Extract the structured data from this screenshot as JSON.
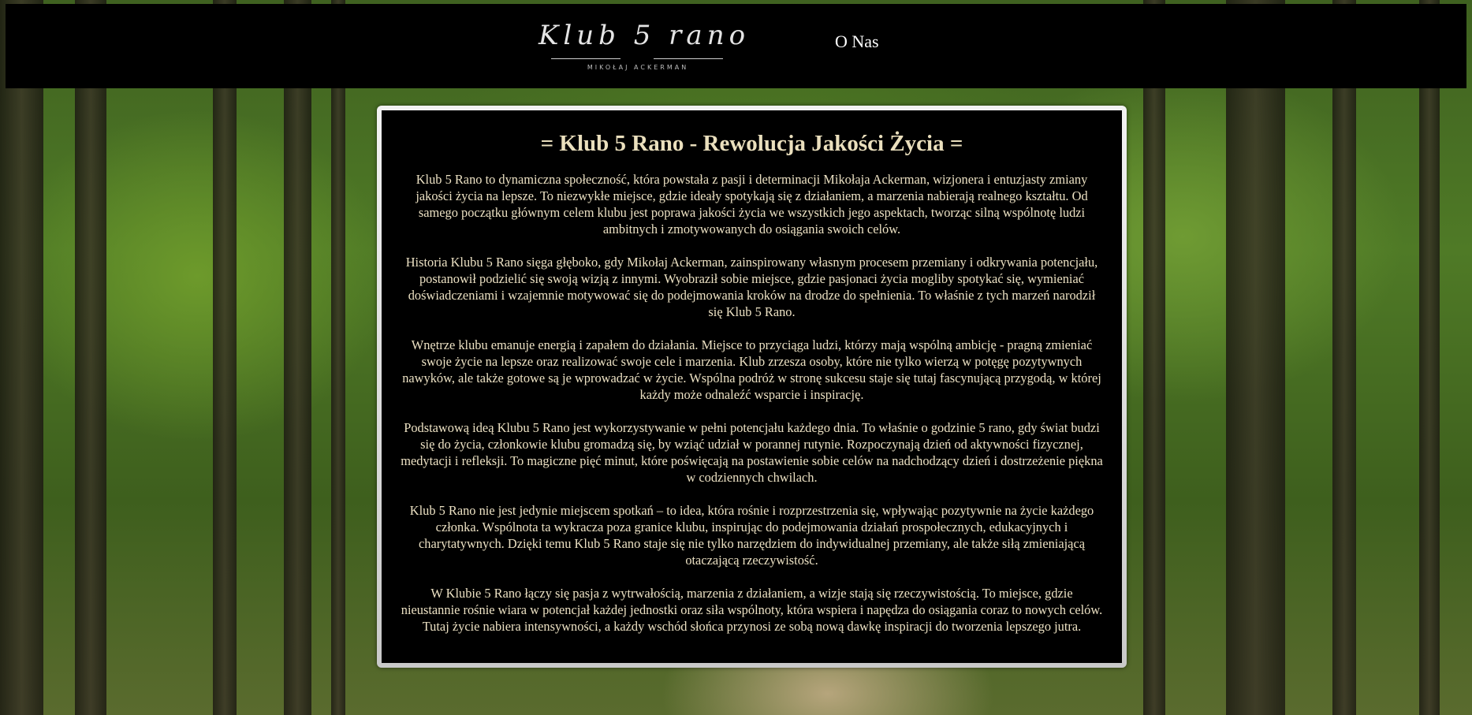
{
  "header": {
    "logo": {
      "script": "Klub 5 rano",
      "subtitle": "MIKOŁAJ ACKERMAN"
    },
    "nav": [
      {
        "label": "O Nas"
      }
    ]
  },
  "content": {
    "title": "= Klub 5 Rano - Rewolucja Jakości Życia =",
    "paragraphs": [
      "Klub 5 Rano to dynamiczna społeczność, która powstała z pasji i determinacji Mikołaja Ackerman, wizjonera i entuzjasty zmiany jakości życia na lepsze. To niezwykłe miejsce, gdzie ideały spotykają się z działaniem, a marzenia nabierają realnego kształtu. Od samego początku głównym celem klubu jest poprawa jakości życia we wszystkich jego aspektach, tworząc silną wspólnotę ludzi ambitnych i zmotywowanych do osiągania swoich celów.",
      "Historia Klubu 5 Rano sięga głęboko, gdy Mikołaj Ackerman, zainspirowany własnym procesem przemiany i odkrywania potencjału, postanowił podzielić się swoją wizją z innymi. Wyobraził sobie miejsce, gdzie pasjonaci życia mogliby spotykać się, wymieniać doświadczeniami i wzajemnie motywować się do podejmowania kroków na drodze do spełnienia. To właśnie z tych marzeń narodził się Klub 5 Rano.",
      "Wnętrze klubu emanuje energią i zapałem do działania. Miejsce to przyciąga ludzi, którzy mają wspólną ambicję - pragną zmieniać swoje życie na lepsze oraz realizować swoje cele i marzenia. Klub zrzesza osoby, które nie tylko wierzą w potęgę pozytywnych nawyków, ale także gotowe są je wprowadzać w życie. Wspólna podróż w stronę sukcesu staje się tutaj fascynującą przygodą, w której każdy może odnaleźć wsparcie i inspirację.",
      "Podstawową ideą Klubu 5 Rano jest wykorzystywanie w pełni potencjału każdego dnia. To właśnie o godzinie 5 rano, gdy świat budzi się do życia, członkowie klubu gromadzą się, by wziąć udział w porannej rutynie. Rozpoczynają dzień od aktywności fizycznej, medytacji i refleksji. To magiczne pięć minut, które poświęcają na postawienie sobie celów na nadchodzący dzień i dostrzeżenie piękna w codziennych chwilach.",
      "Klub 5 Rano nie jest jedynie miejscem spotkań – to idea, która rośnie i rozprzestrzenia się, wpływając pozytywnie na życie każdego członka. Wspólnota ta wykracza poza granice klubu, inspirując do podejmowania działań prospołecznych, edukacyjnych i charytatywnych. Dzięki temu Klub 5 Rano staje się nie tylko narzędziem do indywidualnej przemiany, ale także siłą zmieniającą otaczającą rzeczywistość.",
      "W Klubie 5 Rano łączy się pasja z wytrwałością, marzenia z działaniem, a wizje stają się rzeczywistością. To miejsce, gdzie nieustannie rośnie wiara w potencjał każdej jednostki oraz siła wspólnoty, która wspiera i napędza do osiągania coraz to nowych celów. Tutaj życie nabiera intensywności, a każdy wschód słońca przynosi ze sobą nową dawkę inspiracji do tworzenia lepszego jutra."
    ]
  }
}
